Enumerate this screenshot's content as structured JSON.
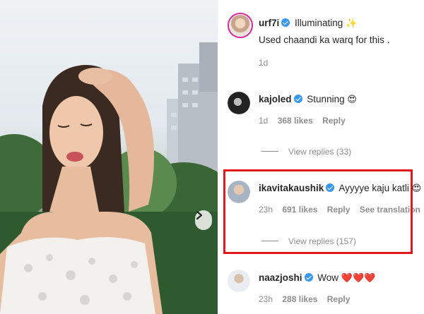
{
  "photo": {
    "next_icon": "chevron-right-icon"
  },
  "comments": [
    {
      "username": "urf7i",
      "text_line1": "Illuminating",
      "text_line1_emoji": "✨",
      "text_line2": "Used chaandi ka warq for this .",
      "time": "1d",
      "verified": true
    },
    {
      "username": "kajoled",
      "text": "Stunning",
      "emoji": "😍",
      "time": "1d",
      "likes": "368 likes",
      "reply": "Reply",
      "view_replies": "View replies (33)",
      "verified": true
    },
    {
      "username": "ikavitakaushik",
      "text": "Ayyyye kaju katli",
      "emoji": "😍",
      "time": "23h",
      "likes": "691 likes",
      "reply": "Reply",
      "translation": "See translation",
      "view_replies": "View replies (157)",
      "verified": true,
      "highlighted": true
    },
    {
      "username": "naazjoshi",
      "text": "Wow",
      "emoji": "❤️❤️❤️",
      "time": "23h",
      "likes": "288 likes",
      "reply": "Reply",
      "verified": true
    }
  ],
  "colors": {
    "highlight": "#e1181e",
    "verified": "#3897f0",
    "meta": "#8e8e8e",
    "heart": "#e0245e"
  }
}
